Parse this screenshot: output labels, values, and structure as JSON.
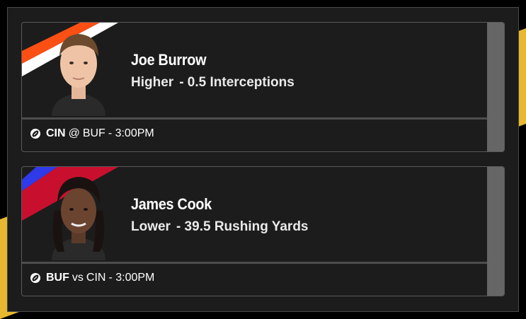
{
  "colors": {
    "page_bg": "#000000",
    "accent_gold": "#e8b830",
    "card_bg": "#1c1c1c",
    "rail": "#666666"
  },
  "picks": [
    {
      "player": "Joe Burrow",
      "direction": "Higher",
      "line": "- 0.5 Interceptions",
      "team": "CIN",
      "connector": "@",
      "opponent": "BUF",
      "time": "- 3:00PM",
      "team_colors": [
        "#fb4f14",
        "#ffffff"
      ],
      "icon": "football-icon"
    },
    {
      "player": "James Cook",
      "direction": "Lower",
      "line": "- 39.5 Rushing Yards",
      "team": "BUF",
      "connector": "vs",
      "opponent": "CIN",
      "time": "- 3:00PM",
      "team_colors": [
        "#2f3ae8",
        "#c8102e"
      ],
      "icon": "football-icon"
    }
  ]
}
